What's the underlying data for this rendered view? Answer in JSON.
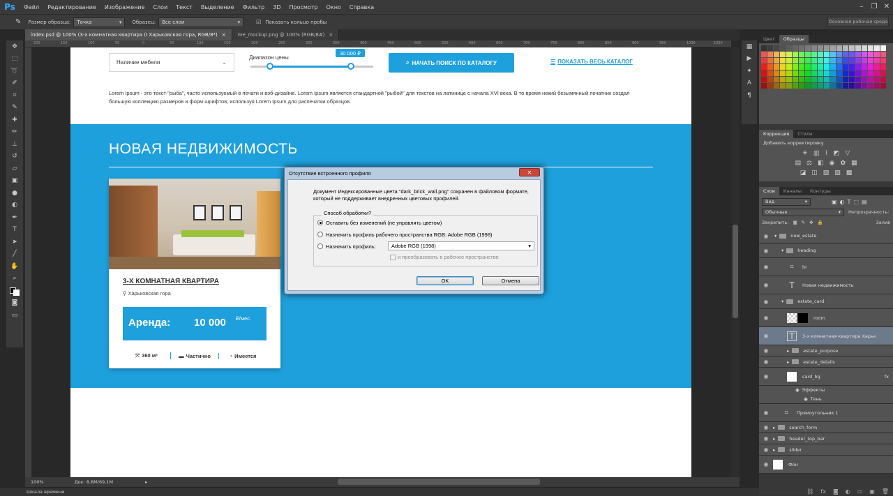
{
  "app": {
    "logo": "Ps",
    "menu": [
      "Файл",
      "Редактирование",
      "Изображение",
      "Слои",
      "Текст",
      "Выделение",
      "Фильтр",
      "3D",
      "Просмотр",
      "Окно",
      "Справка"
    ],
    "window_controls": [
      "–",
      "❐",
      "✕"
    ]
  },
  "options": {
    "size_label": "Размер образца:",
    "size_value": "Точка",
    "sample_label": "Образец:",
    "sample_value": "Все слои",
    "ring_label": "Показать кольцо пробы",
    "workspace": "Основная рабочая среда"
  },
  "tabs": [
    {
      "label": "index.psd @ 100% (3-х комнатная квартира (I Харьковская гора, RGB/8*)",
      "close": "×"
    },
    {
      "label": "me_mockup.png @ 100% (RGB/8#)",
      "close": "×"
    }
  ],
  "ruler_marks": [
    "200",
    "150",
    "100",
    "50",
    "0",
    "50",
    "100",
    "150",
    "200",
    "250",
    "300",
    "350",
    "400",
    "450",
    "500",
    "550",
    "600",
    "650",
    "700",
    "750",
    "800",
    "850",
    "900",
    "950",
    "1000",
    "1050"
  ],
  "site": {
    "select_label": "Наличие мебели",
    "range_label": "Диапазон цены",
    "range_value": "30 000 ₽",
    "search_button": "НАЧАТЬ ПОИСК ПО КАТАЛОГУ",
    "catalog_link": "ПОКАЗАТЬ ВЕСЬ КАТАЛОГ",
    "lorem": "Lorem Ipsum - это текст-\"рыба\", часто используемый в печати и вэб-дизайне. Lorem Ipsum является стандартной \"рыбой\" для текстов на латинице с начала XVI века. В то время некий безымянный печатник создал большую коллекцию размеров и форм шрифтов, используя Lorem Ipsum для распечатки образцов.",
    "section_title": "НОВАЯ НЕДВИЖИМОСТЬ",
    "card": {
      "title": "3-Х КОМНАТНАЯ КВАРТИРА",
      "location": "Харьковская гора",
      "rent_label": "Аренда:",
      "rent_value": "10 000",
      "rent_unit": "₽/мес.",
      "features": [
        "360 м²",
        "Частично",
        "Имеется"
      ]
    }
  },
  "dialog": {
    "title": "Отсутствие встроенного профиля",
    "message": "Документ Индексированные цвета \"dark_brick_wall.png\" сохранен в файловом формате,  который не поддерживает внедренных цветовых профилей.",
    "group_title": "Способ обработки?",
    "options": [
      "Оставить без изменений (не управлять цветом)",
      "Назначить профиль рабочего пространства RGB:  Adobe RGB (1998)",
      "Назначить профиль:"
    ],
    "profile_value": "Adobe RGB (1998)",
    "convert_label": "и преобразовать в рабочее пространство",
    "ok": "OK",
    "cancel": "Отмена"
  },
  "panels": {
    "swatch_tabs": [
      "Цвет",
      "Образцы"
    ],
    "adjust_tabs": [
      "Коррекция",
      "Стили"
    ],
    "adjust_title": "Добавить корректировку",
    "layer_tabs": [
      "Слои",
      "Каналы",
      "Контуры"
    ],
    "kind": "Вид",
    "blend": "Обычные",
    "opacity": "Непрозрачность:",
    "lock": "Закрепить:",
    "fill": "Залив",
    "layers": [
      "new_estate",
      "heading",
      "hr",
      "Новая недвижимость",
      "estate_card",
      "room",
      "3-х комнатная квартира Харьк",
      "estate_purpose",
      "estate_details",
      "card_bg",
      "Эффекты",
      "Тень",
      "Прямоугольник 1",
      "search_form",
      "header_top_bar",
      "slider",
      "Фон"
    ]
  },
  "status": {
    "zoom": "100%",
    "doc": "Док: 8,8М/69,1М"
  },
  "timeline": "Шкала времени",
  "colors": {
    "accent": "#1ea0dc",
    "ps_bg": "#282828",
    "panel": "#383838"
  }
}
